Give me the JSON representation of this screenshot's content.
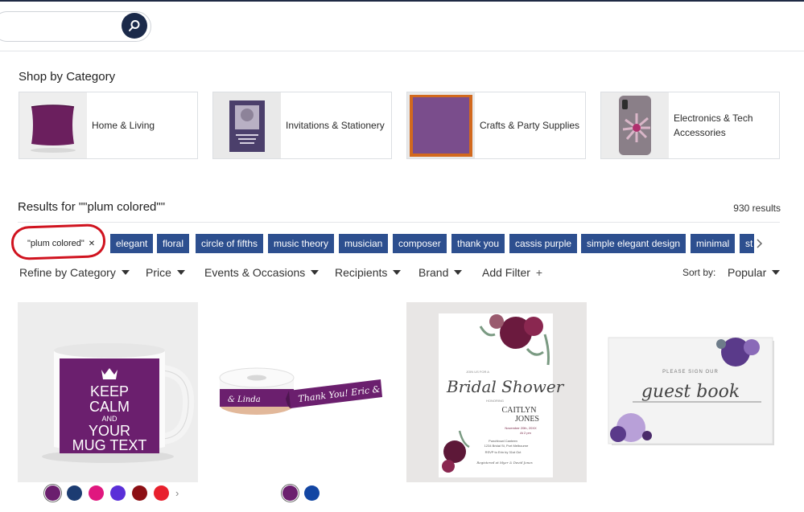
{
  "header": {
    "search_placeholder": ""
  },
  "categories": {
    "title": "Shop by Category",
    "items": [
      {
        "label": "Home & Living"
      },
      {
        "label": "Invitations & Stationery"
      },
      {
        "label": "Crafts & Party Supplies"
      },
      {
        "label": "Electronics & Tech Accessories"
      }
    ]
  },
  "results": {
    "title": "Results for \"\"plum colored\"\"",
    "count": "930 results",
    "active_tag": "\"plum colored\"",
    "active_tag_remove": "✕",
    "tags": [
      "elegant",
      "floral",
      "circle of fifths",
      "music theory",
      "musician",
      "composer",
      "thank you",
      "cassis purple",
      "simple elegant design",
      "minimal",
      "st"
    ]
  },
  "filters": {
    "items": [
      "Refine by Category",
      "Price",
      "Events & Occasions",
      "Recipients",
      "Brand"
    ],
    "add_filter": "Add Filter",
    "add_symbol": "+",
    "sort_label": "Sort by:",
    "sort_value": "Popular"
  },
  "products": {
    "mug_text": [
      "KEEP",
      "CALM",
      "AND",
      "YOUR",
      "MUG TEXT"
    ],
    "ribbon_text": "Thank You! Eric & Linda",
    "ribbon_text_short": "& Linda",
    "invite_top": "JOIN US FOR A",
    "invite_script": "Bridal Shower",
    "invite_honoring": "HONORING",
    "invite_name1": "CAITLYN",
    "invite_name2": "JONES",
    "invite_date": "November 20th, 20XX",
    "invite_time": "At 2 pm",
    "invite_place": "Punchbowl Canteen",
    "invite_address": "1234 Bridal St, Port Melbourne",
    "invite_rsvp": "RSVP to Erin by 31st Oct",
    "invite_registry": "Registered at Myer & David Jones",
    "guest_small": "PLEASE SIGN OUR",
    "guest_script": "guest book"
  },
  "swatches": {
    "mug": [
      "#6b1f6e",
      "#1c3c72",
      "#e0177f",
      "#5a2fd8",
      "#8c0f14",
      "#e8202d"
    ],
    "ribbon": [
      "#6b1f6e",
      "#1346a3"
    ],
    "more": "›"
  },
  "colors": {
    "tag_bg": "#2d4f8f",
    "plum": "#6b1f6e",
    "highlight_circle": "#d0131f"
  }
}
